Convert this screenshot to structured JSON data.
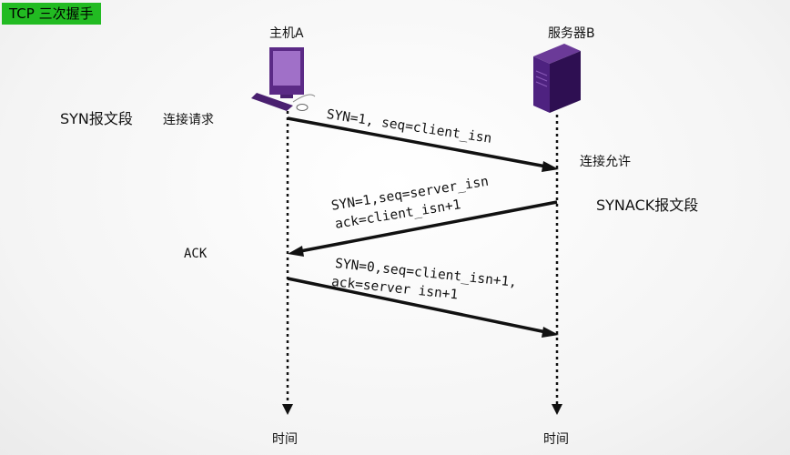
{
  "title": "TCP 三次握手",
  "host": {
    "label": "主机A",
    "time_label": "时间"
  },
  "server": {
    "label": "服务器B",
    "time_label": "时间"
  },
  "messages": {
    "syn_line": "SYN=1, seq=client_isn",
    "synack_line1": "SYN=1,seq=server_isn",
    "synack_line2": "ack=client_isn+1",
    "ack_line1": "SYN=0,seq=client_isn+1,",
    "ack_line2": "ack=server isn+1"
  },
  "annotations": {
    "syn_segment": "SYN报文段",
    "connect_request": "连接请求",
    "connect_allow": "连接允许",
    "synack_segment": "SYNACK报文段",
    "ack": "ACK"
  },
  "colors": {
    "title_bg": "#22bb22",
    "computer": "#5b2a86",
    "screen": "#a070c8",
    "server": "#3f1766",
    "line": "#111111"
  },
  "icons": {
    "host": "desktop-computer-icon",
    "server": "server-tower-icon"
  }
}
